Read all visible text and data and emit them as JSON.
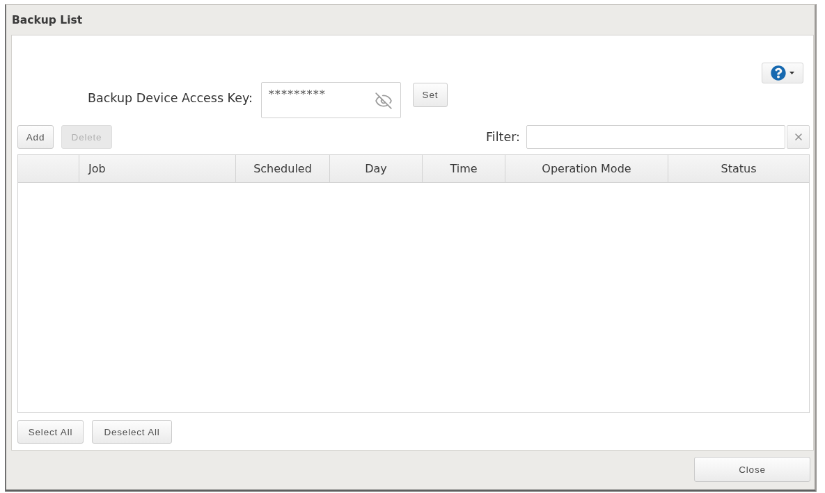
{
  "window": {
    "title": "Backup List"
  },
  "access_key": {
    "label": "Backup Device Access Key:",
    "value": "*********",
    "visible": false,
    "button": "Set"
  },
  "toolbar": [
    {
      "label": "Add",
      "disabled": false
    },
    {
      "label": "Delete",
      "disabled": true
    }
  ],
  "filter": {
    "label": "Filter:"
  },
  "table": {
    "columns": [
      "Job",
      "Scheduled",
      "Day",
      "Time",
      "Operation Mode",
      "Status"
    ]
  },
  "bottom_buttons": [
    "Select All",
    "Deselect All"
  ],
  "footer": {
    "close_button": "Close"
  }
}
